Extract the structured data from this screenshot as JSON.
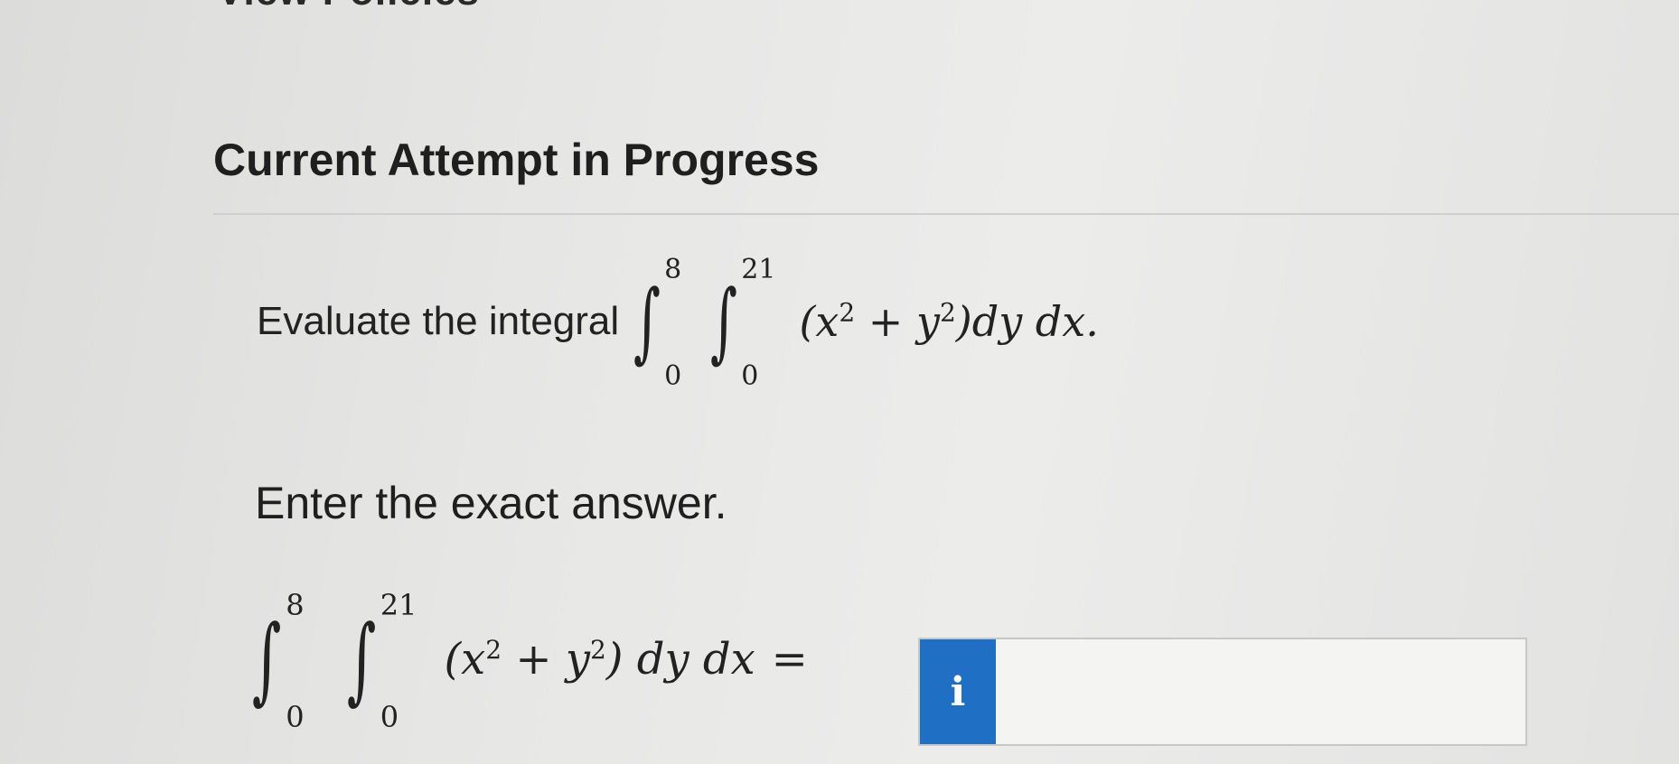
{
  "header": {
    "partial_text": "View Policies"
  },
  "section": {
    "title": "Current Attempt in Progress"
  },
  "question": {
    "prompt": "Evaluate the integral",
    "outer_upper": "8",
    "outer_lower": "0",
    "inner_upper": "21",
    "inner_lower": "0",
    "integrand_open": "(x",
    "exp1": "2",
    "plus_y": " + y",
    "exp2": "2",
    "integrand_close": ")dy dx."
  },
  "instruction": {
    "text": "Enter the exact answer."
  },
  "answer": {
    "outer_upper": "8",
    "outer_lower": "0",
    "inner_upper": "21",
    "inner_lower": "0",
    "integrand_open": "(x",
    "exp1": "2",
    "plus_y": " + y",
    "exp2": "2",
    "integrand_close": ") dy dx",
    "equals": "=",
    "info_label": "i",
    "input_value": ""
  },
  "colors": {
    "info_button": "#1f6fc4",
    "background": "#e7e7e6"
  }
}
